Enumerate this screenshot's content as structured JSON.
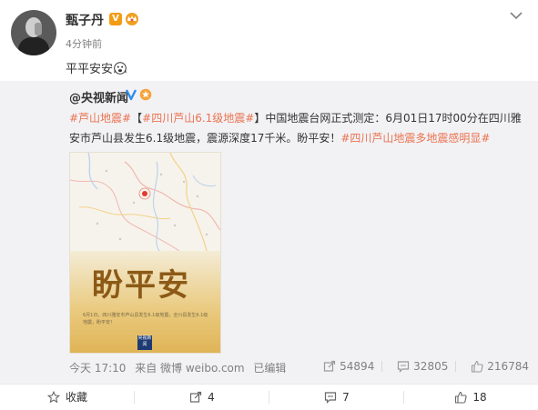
{
  "post": {
    "username": "甄子丹",
    "time": "4分钟前",
    "text": "平平安安"
  },
  "repost": {
    "author": "@央视新闻",
    "text_parts": [
      {
        "t": "#芦山地震#",
        "tag": true
      },
      {
        "t": "【",
        "tag": false
      },
      {
        "t": "#四川芦山6.1级地震#",
        "tag": true
      },
      {
        "t": "】中国地震台网正式测定：6月01日17时00分在四川雅安市芦山县发生6.1级地震，震源深度17千米。盼平安！",
        "tag": false
      },
      {
        "t": "#四川芦山地震多地震感明显#",
        "tag": true
      }
    ],
    "image": {
      "title": "盼平安",
      "caption": "6月1日，四川雅安市芦山县发生6.1级地震，全川县发生6.1级地震，盼平安！",
      "logo": "央视新闻"
    },
    "footer": {
      "time": "今天 17:10",
      "source": "来自 微博 weibo.com",
      "edited": "已编辑"
    },
    "stats": {
      "reposts": "54894",
      "comments": "32805",
      "likes": "216784"
    }
  },
  "actions": {
    "favorite": "收藏",
    "repost": "4",
    "comment": "7",
    "like": "18"
  },
  "colors": {
    "tag": "#eb7350",
    "repost_bg": "#f2f2f5",
    "vip_orange": "#f39c12"
  }
}
